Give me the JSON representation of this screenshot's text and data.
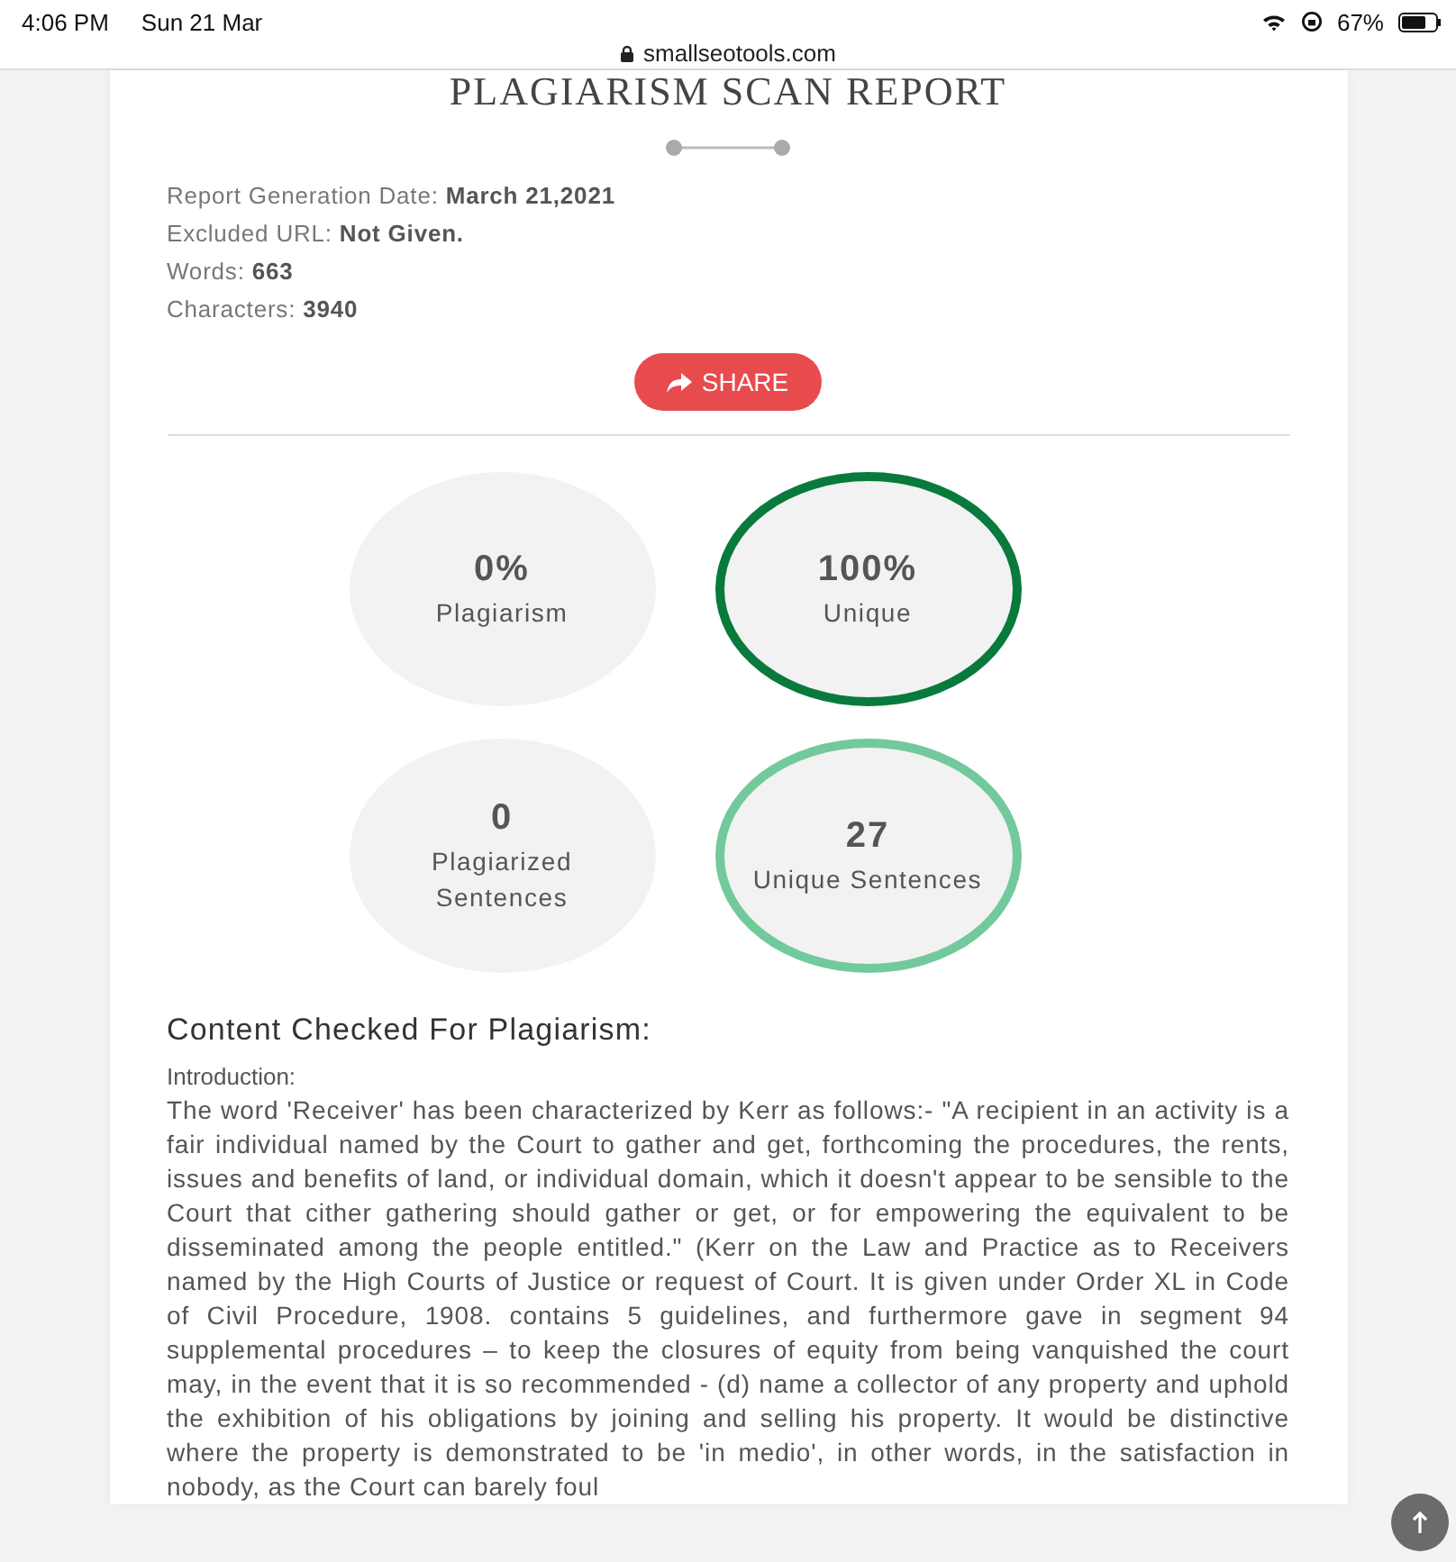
{
  "status_bar": {
    "time": "4:06 PM",
    "date": "Sun 21 Mar",
    "url": "smallseotools.com",
    "battery": "67%"
  },
  "report": {
    "title": "PLAGIARISM SCAN REPORT",
    "details": [
      {
        "label": "Report Generation Date:",
        "value": "March 21,2021"
      },
      {
        "label": "Excluded URL:",
        "value": "Not Given."
      },
      {
        "label": "Words:",
        "value": "663"
      },
      {
        "label": "Characters:",
        "value": "3940"
      }
    ],
    "share_button": "SHARE",
    "stats": [
      {
        "value": "0%",
        "label": "Plagiarism"
      },
      {
        "value": "100%",
        "label": "Unique",
        "color": "#087a3c"
      },
      {
        "value": "0",
        "label": "Plagiarized Sentences"
      },
      {
        "value": "27",
        "label": "Unique Sentences",
        "color": "#72c99b"
      }
    ],
    "content_heading": "Content Checked For Plagiarism:",
    "content_intro": "Introduction:",
    "content_text": "The word 'Receiver' has been characterized by Kerr as follows:- \"A recipient in an activity is a fair individual named by the Court to gather and get, forthcoming the procedures, the rents, issues and benefits of land, or individual domain, which it doesn't appear to be sensible to the Court that cither gathering should gather or get, or for empowering the equivalent to be disseminated among the people entitled.\" (Kerr on the Law and Practice as to Receivers named by the High Courts of Justice or request of Court. It is given under Order XL in Code of Civil Procedure, 1908. contains 5 guidelines, and furthermore gave in segment 94 supplemental procedures – to keep the closures of equity from being vanquished the court may, in the event that it is so recommended - (d) name a collector of any property and uphold the exhibition of his obligations by joining and selling his property. It would be distinctive where the property is demonstrated to be 'in medio', in other words, in the satisfaction in nobody, as the Court can barely foul"
  }
}
